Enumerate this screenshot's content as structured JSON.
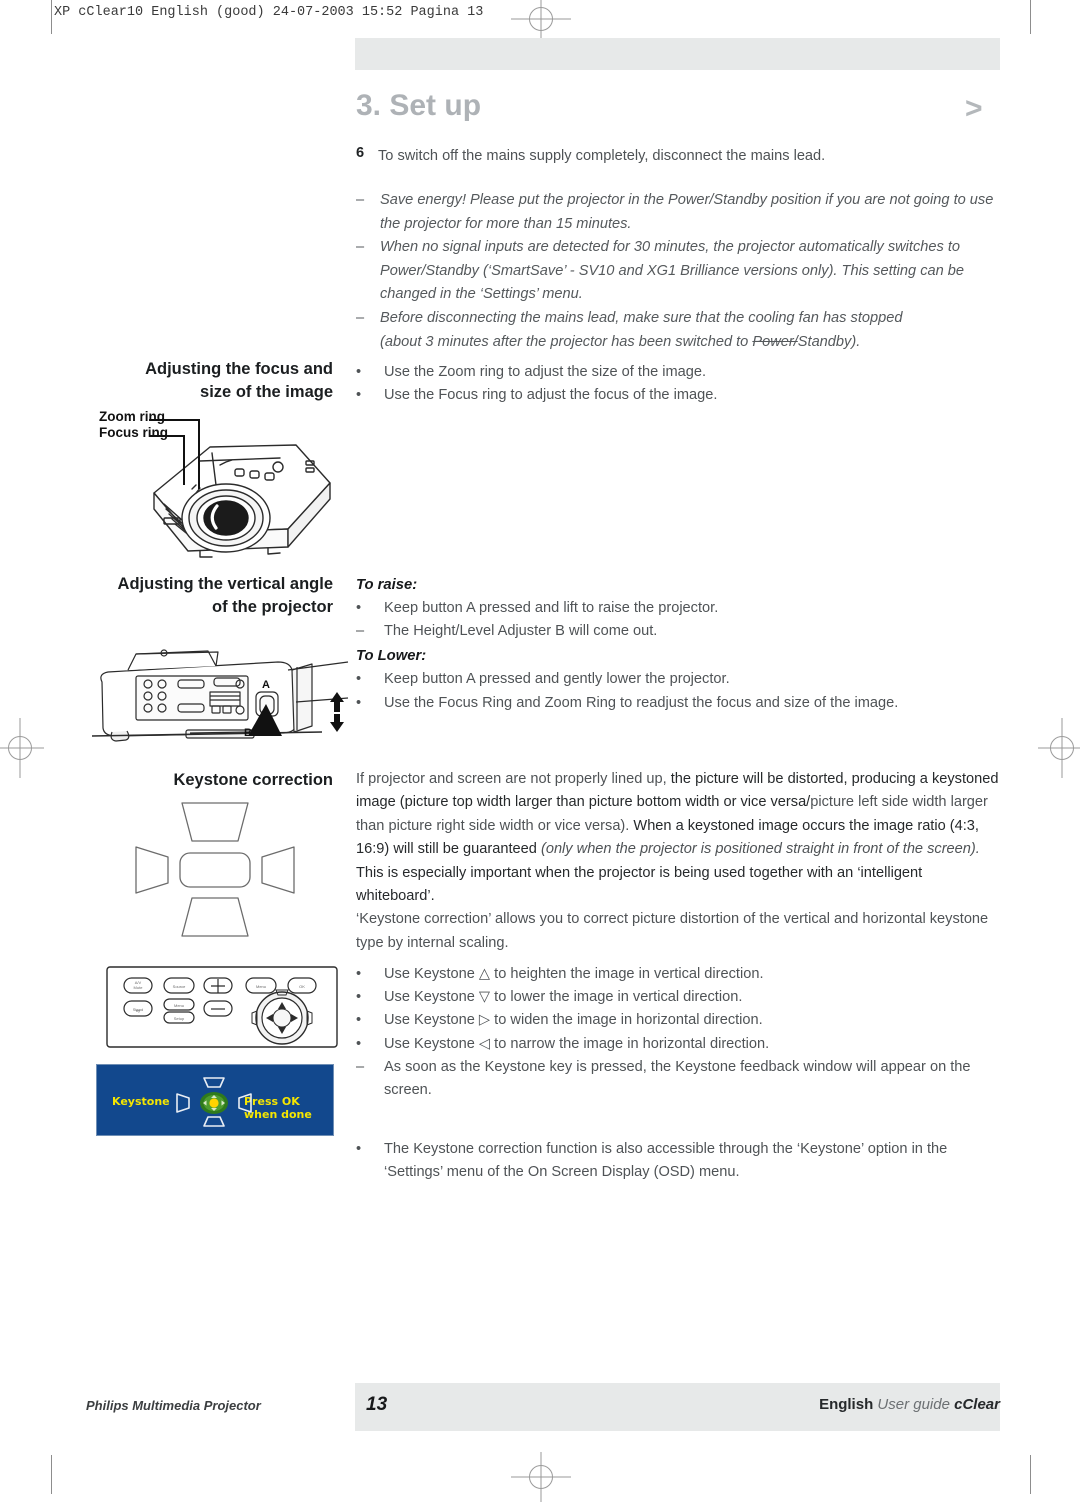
{
  "header": {
    "print_slug": "XP cClear10 English (good)  24-07-2003  15:52  Pagina 13"
  },
  "title": {
    "text": "3. Set up",
    "chevron": ">",
    "color": "#aeb2b6"
  },
  "intro": {
    "number": "6",
    "text": "To switch off the mains supply completely, disconnect the mains lead."
  },
  "notes": [
    {
      "marker": "–",
      "text": "Save energy! Please put the projector in the Power/Standby position if you are not going to use the projector for more than 15 minutes."
    },
    {
      "marker": "–",
      "text": "When no signal inputs are detected for 30 minutes, the projector automatically switches to Power/Standby (‘SmartSave’ - SV10 and XG1 Brilliance versions only). This setting can be changed in the ‘Settings’ menu."
    },
    {
      "marker": "–",
      "text": "Before disconnecting the mains lead, make sure that the cooling fan has stopped (about 3 minutes after the projector has been switched to Power/Standby)."
    }
  ],
  "sections": {
    "focus": {
      "heading_line1": "Adjusting the focus and",
      "heading_line2": "size of the image",
      "bullets": [
        {
          "marker": "•",
          "text": "Use the Zoom ring to adjust the size of the image."
        },
        {
          "marker": "•",
          "text": "Use the Focus ring to adjust the focus of the image."
        }
      ],
      "figure_labels": {
        "zoom_ring": "Zoom ring",
        "focus_ring": "Focus ring"
      }
    },
    "vertical": {
      "heading_line1": "Adjusting the vertical angle",
      "heading_line2": "of the projector",
      "to_raise_label": "To raise:",
      "to_raise": [
        {
          "marker": "•",
          "text": "Keep button A pressed and lift to raise the projector."
        },
        {
          "marker": "–",
          "text": "The Height/Level Adjuster B will come out."
        }
      ],
      "to_lower_label": "To Lower:",
      "to_lower": [
        {
          "marker": "•",
          "text": "Keep button A pressed and gently lower the projector."
        },
        {
          "marker": "•",
          "text": "Use the Focus Ring and Zoom Ring to readjust the focus and size of the image."
        }
      ],
      "figure_labels": {
        "button_a": "A",
        "adjuster_b": "B"
      }
    },
    "keystone": {
      "heading": "Keystone correction",
      "paragraph1_part1": "If projector and screen are not properly lined up,",
      "paragraph1_part2": " the picture will be distorted, producing a keystoned image (picture top width larger than picture bottom width or vice versa/",
      "paragraph1_part3": "picture left side width larger than picture right side width or vice versa).",
      "paragraph1_part4": " When a keystoned image occurs the image ratio (4:3, 16:9) will still be guaranteed ",
      "paragraph1_italic": "(only when the projector is positioned straight in front of the screen).",
      "paragraph1_part5": " This is especially important when the projector is being used together with an ‘intelligent whiteboard’.",
      "paragraph2": "‘Keystone correction’ allows you to correct picture distortion of the vertical and horizontal keystone type by internal scaling.",
      "bullets": [
        {
          "marker": "•",
          "text": "Use Keystone △ to heighten the image in vertical direction."
        },
        {
          "marker": "•",
          "text": "Use Keystone ▽ to lower the image in vertical direction."
        },
        {
          "marker": "•",
          "text": "Use Keystone ▷ to widen the image in horizontal direction."
        },
        {
          "marker": "•",
          "text": "Use Keystone ◁ to narrow the image in horizontal direction."
        },
        {
          "marker": "–",
          "text": "As soon as the Keystone key is pressed, the Keystone feedback window will appear on the screen."
        }
      ],
      "final_bullet": {
        "marker": "•",
        "text": "The Keystone correction function is also accessible through the ‘Keystone’ option in the ‘Settings’ menu of the On Screen Display (OSD) menu."
      }
    }
  },
  "osd": {
    "label": "Keystone",
    "hint": "Press OK when done",
    "bg_color": "#12488d",
    "text_color": "#f5e600",
    "dpad_color": "#3d8a25",
    "dpad_center_color": "#ffd300"
  },
  "footer": {
    "left": "Philips Multimedia Projector",
    "page": "13",
    "right_bold": "English",
    "right_grey": "User guide",
    "right_brand": "cClear"
  }
}
